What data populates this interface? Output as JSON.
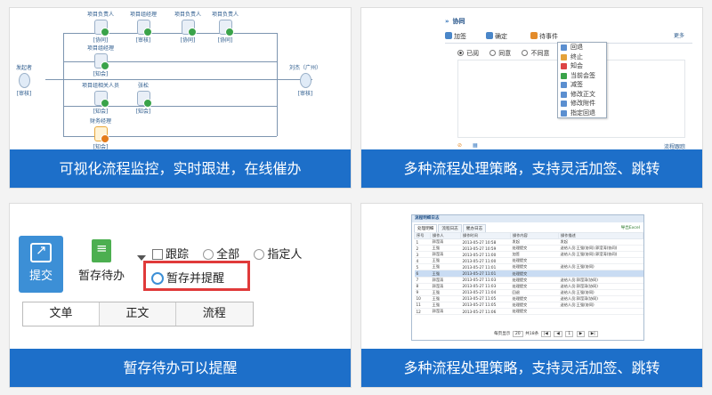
{
  "tiles": [
    {
      "caption": "可视化流程监控，实时跟进，在线催办",
      "flow": {
        "nodes": [
          {
            "title": "项目负责人",
            "role": "[协同]"
          },
          {
            "title": "项目组经理",
            "role": "[审核]"
          },
          {
            "title": "项目负责人",
            "role": "[协同]"
          },
          {
            "title": "项目负责人",
            "role": "[协同]"
          },
          {
            "title": "项目组经理",
            "role": "[知会]"
          },
          {
            "title": "项目组相关人员",
            "role": "[知会]"
          },
          {
            "title": "张松",
            "role": "[知会]"
          },
          {
            "title": "财务经理",
            "role": "[知会]"
          },
          {
            "title": "发起者",
            "role": "[审核]"
          },
          {
            "title": "刘杰（广州）",
            "role": "[审核]"
          }
        ]
      }
    },
    {
      "caption": "多种流程处理策略，支持灵活加签、跳转",
      "window": {
        "title": "协同",
        "toolbar": {
          "add": "加签",
          "confirm": "确定",
          "handle": "待事件",
          "more": "更多"
        },
        "radios": {
          "agree": "已阅",
          "consent": "同意",
          "disagree": "不同意"
        },
        "menu": [
          "回退",
          "终止",
          "知会",
          "当前会签",
          "减签",
          "修改正文",
          "修改附件",
          "指定回退"
        ],
        "bottom_right": "流程跟踪"
      }
    },
    {
      "caption": "暂存待办可以提醒",
      "toolbar": {
        "submit": "提交",
        "save_pending": "暂存待办",
        "track": "跟踪",
        "all": "全部",
        "assignee": "指定人",
        "save_remind": "暂存并提醒",
        "tabs": [
          "文单",
          "正文",
          "流程"
        ]
      }
    },
    {
      "caption": "多种流程处理策略，支持灵活加签、跳转",
      "log_window": {
        "title": "流程明细日志",
        "tabs": [
          "处理明细",
          "流程日志",
          "催办日志"
        ],
        "export": "导出Excel",
        "headers": [
          "序号",
          "操作人",
          "操作时间",
          "操作内容",
          "操作描述"
        ],
        "rows": [
          [
            "1",
            "郭滢涛",
            "2013-05-27 10:58",
            "发起",
            "发起"
          ],
          [
            "2",
            "王强",
            "2013-05-27 10:59",
            "处理提交",
            "送给人员:王强(协同);郭滢涛(协同)"
          ],
          [
            "3",
            "郭滢涛",
            "2013-05-27 11:00",
            "加签",
            "送给人员:王强(协同);郭滢涛(协同)"
          ],
          [
            "4",
            "王强",
            "2013-05-27 11:00",
            "处理提交",
            ""
          ],
          [
            "5",
            "王强",
            "2013-05-27 11:01",
            "处理提交",
            "送给人员:王强(协同)"
          ],
          [
            "6",
            "王强",
            "2013-05-27 11:01",
            "处理提交",
            ""
          ],
          [
            "7",
            "郭滢涛",
            "2013-05-27 11:03",
            "处理提交",
            "送给人员:郭滢涛(协同)"
          ],
          [
            "8",
            "郭滢涛",
            "2013-05-27 11:03",
            "处理提交",
            "送给人员:郭滢涛(协同)"
          ],
          [
            "9",
            "王强",
            "2013-05-27 11:04",
            "回退",
            "送给人员:王强(协同)"
          ],
          [
            "10",
            "王强",
            "2013-05-27 11:05",
            "处理提交",
            "送给人员:郭滢涛(协同)"
          ],
          [
            "11",
            "王强",
            "2013-05-27 11:05",
            "处理提交",
            "送给人员:王强(协同)"
          ],
          [
            "12",
            "郭滢涛",
            "2013-05-27 11:06",
            "处理提交",
            ""
          ]
        ],
        "pager": {
          "per_page_label": "每页显示",
          "per_page": "20",
          "total": "共18条",
          "page": "1"
        }
      }
    }
  ],
  "colors": {
    "caption_bg": "#1d6fc9",
    "highlight_border": "#e03a3a",
    "accent": "#3c8fd6"
  }
}
